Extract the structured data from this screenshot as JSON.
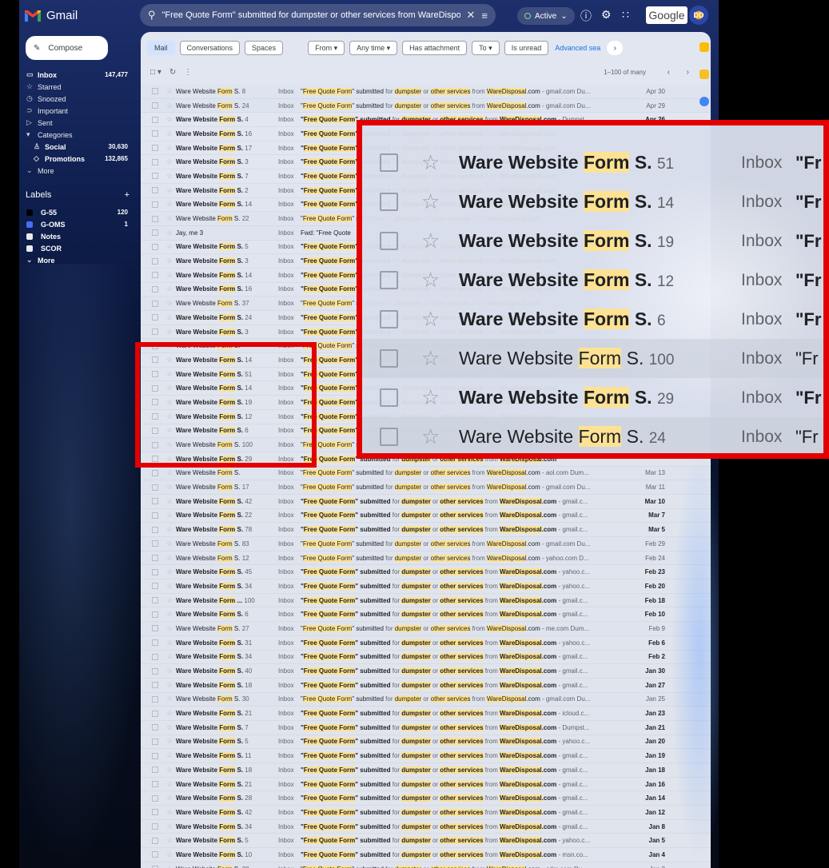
{
  "app": {
    "name": "Gmail",
    "google_label": "Google"
  },
  "search": {
    "query": "\"Free Quote Form\" submitted for dumpster or other services from WareDisposal",
    "clear_icon": "close-icon",
    "options_icon": "tune-icon"
  },
  "status": {
    "label": "Active"
  },
  "header_icons": [
    "help-icon",
    "settings-icon",
    "apps-icon"
  ],
  "avatar": {
    "initials": "DD"
  },
  "compose": {
    "label": "Compose"
  },
  "nav": [
    {
      "label": "Inbox",
      "count": "147,477",
      "bold": true,
      "icon": "inbox-icon",
      "glyph": "▭"
    },
    {
      "label": "Starred",
      "count": "",
      "bold": false,
      "icon": "star-icon",
      "glyph": "☆"
    },
    {
      "label": "Snoozed",
      "count": "",
      "bold": false,
      "icon": "clock-icon",
      "glyph": "◷"
    },
    {
      "label": "Important",
      "count": "",
      "bold": false,
      "icon": "important-icon",
      "glyph": "⊃"
    },
    {
      "label": "Sent",
      "count": "",
      "bold": false,
      "icon": "send-icon",
      "glyph": "▷"
    },
    {
      "label": "Categories",
      "count": "",
      "bold": false,
      "icon": "category-icon",
      "glyph": "▾"
    },
    {
      "label": "Social",
      "count": "30,630",
      "bold": true,
      "icon": "people-icon",
      "glyph": "♙",
      "sub": true
    },
    {
      "label": "Promotions",
      "count": "132,865",
      "bold": true,
      "icon": "tag-icon",
      "glyph": "◇",
      "sub": true
    },
    {
      "label": "More",
      "count": "",
      "bold": false,
      "icon": "chevron-down-icon",
      "glyph": "⌄"
    }
  ],
  "labels": {
    "title": "Labels",
    "add_glyph": "+",
    "items": [
      {
        "label": "G-55",
        "count": "120",
        "color": "#000000"
      },
      {
        "label": "G-OMS",
        "count": "1",
        "color": "#4a6cf7"
      },
      {
        "label": "Notes",
        "count": "",
        "color": "#e8eaed"
      },
      {
        "label": "SCOR",
        "count": "",
        "color": "#e8eaed"
      },
      {
        "label": "More",
        "count": "",
        "color": ""
      }
    ]
  },
  "filters": {
    "tabs": [
      "Mail",
      "Conversations",
      "Spaces"
    ],
    "chips": [
      "From ▾",
      "Any time ▾",
      "Has attachment",
      "To ▾",
      "Is unread"
    ],
    "advanced": "Advanced sea"
  },
  "toolbar": {
    "range": "1–100 of many"
  },
  "sender_base": "Ware Website ",
  "sender_highlight": "Form",
  "subject": {
    "q1": "\"",
    "hl1": "Free Quote Form",
    "q2": "\" ",
    "w1": "submitted",
    "w2": " for ",
    "hl2": "dumpster",
    "w3": " or ",
    "hl3": "other services",
    "w4": " from ",
    "hl4": "WareDisposal",
    "w5": ".com"
  },
  "inbox_label": "Inbox",
  "emails": [
    {
      "s": "S.",
      "n": "8",
      "u": false,
      "tail": " - gmail.com Du...",
      "d": "Apr 30"
    },
    {
      "s": "S.",
      "n": "24",
      "u": false,
      "tail": " - gmail.com Du...",
      "d": "Apr 29"
    },
    {
      "s": "S.",
      "n": "4",
      "u": true,
      "tail": " - Dumpst...",
      "d": "Apr 26"
    },
    {
      "s": "S.",
      "n": "16",
      "u": true,
      "tail": "",
      "d": ""
    },
    {
      "s": "S.",
      "n": "17",
      "u": true,
      "tail": "",
      "d": ""
    },
    {
      "s": "S.",
      "n": "3",
      "u": true,
      "tail": "",
      "d": ""
    },
    {
      "s": "S.",
      "n": "7",
      "u": true,
      "tail": "",
      "d": ""
    },
    {
      "s": "S.",
      "n": "2",
      "u": true,
      "tail": "",
      "d": ""
    },
    {
      "s": "S.",
      "n": "14",
      "u": true,
      "tail": "",
      "d": ""
    },
    {
      "s": "S.",
      "n": "22",
      "u": false,
      "tail": "",
      "d": ""
    },
    {
      "sender": "Jay, me 3",
      "u": false,
      "tail": "",
      "d": "",
      "fwd": "Fwd: \"Free Quote"
    },
    {
      "s": "S.",
      "n": "5",
      "u": true,
      "tail": "",
      "d": ""
    },
    {
      "s": "S.",
      "n": "3",
      "u": true,
      "tail": "",
      "d": ""
    },
    {
      "s": "S.",
      "n": "14",
      "u": true,
      "tail": "",
      "d": ""
    },
    {
      "s": "S.",
      "n": "16",
      "u": true,
      "tail": "",
      "d": ""
    },
    {
      "s": "S.",
      "n": "37",
      "u": false,
      "tail": "",
      "d": ""
    },
    {
      "s": "S.",
      "n": "24",
      "u": true,
      "tail": "",
      "d": ""
    },
    {
      "s": "S.",
      "n": "3",
      "u": true,
      "tail": "",
      "d": ""
    },
    {
      "s": "S.",
      "n": "",
      "u": false,
      "tail": "",
      "d": ""
    },
    {
      "s": "S.",
      "n": "14",
      "u": true,
      "tail": "",
      "d": ""
    },
    {
      "s": "S.",
      "n": "51",
      "u": true,
      "tail": "",
      "d": ""
    },
    {
      "s": "S.",
      "n": "14",
      "u": true,
      "tail": "",
      "d": ""
    },
    {
      "s": "S.",
      "n": "19",
      "u": true,
      "tail": "",
      "d": ""
    },
    {
      "s": "S.",
      "n": "12",
      "u": true,
      "tail": "",
      "d": ""
    },
    {
      "s": "S.",
      "n": "6",
      "u": true,
      "tail": "",
      "d": ""
    },
    {
      "s": "S.",
      "n": "100",
      "u": false,
      "tail": "",
      "d": ""
    },
    {
      "s": "S.",
      "n": "29",
      "u": true,
      "tail": "",
      "d": ""
    },
    {
      "s": "S.",
      "n": "",
      "u": false,
      "tail": " - aol.com Dum...",
      "d": "Mar 13"
    },
    {
      "s": "S.",
      "n": "17",
      "u": false,
      "tail": " - gmail.com Du...",
      "d": "Mar 11"
    },
    {
      "s": "S.",
      "n": "42",
      "u": true,
      "tail": " - gmail.c...",
      "d": "Mar 10"
    },
    {
      "s": "S.",
      "n": "22",
      "u": true,
      "tail": " - gmail.c...",
      "d": "Mar 7"
    },
    {
      "s": "S.",
      "n": "78",
      "u": true,
      "tail": " - gmail.c...",
      "d": "Mar 5"
    },
    {
      "s": "S.",
      "n": "83",
      "u": false,
      "tail": " - gmail.com Du...",
      "d": "Feb 29"
    },
    {
      "s": "S.",
      "n": "12",
      "u": false,
      "tail": " - yahoo.com D...",
      "d": "Feb 24"
    },
    {
      "s": "S.",
      "n": "45",
      "u": true,
      "tail": " - yahoo.c...",
      "d": "Feb 23"
    },
    {
      "s": "S.",
      "n": "34",
      "u": true,
      "tail": " - yahoo.c...",
      "d": "Feb 20"
    },
    {
      "s": "...",
      "n": "100",
      "u": true,
      "tail": " - gmail.c...",
      "d": "Feb 18"
    },
    {
      "s": "S.",
      "n": "6",
      "u": true,
      "tail": " - gmail.c...",
      "d": "Feb 10"
    },
    {
      "s": "S.",
      "n": "27",
      "u": false,
      "tail": " - me.com Dum...",
      "d": "Feb 9"
    },
    {
      "s": "S.",
      "n": "31",
      "u": true,
      "tail": " - yahoo.c...",
      "d": "Feb 6"
    },
    {
      "s": "S.",
      "n": "34",
      "u": true,
      "tail": " - gmail.c...",
      "d": "Feb 2"
    },
    {
      "s": "S.",
      "n": "40",
      "u": true,
      "tail": " - gmail.c...",
      "d": "Jan 30"
    },
    {
      "s": "S.",
      "n": "18",
      "u": true,
      "tail": " - gmail.c...",
      "d": "Jan 27"
    },
    {
      "s": "S.",
      "n": "30",
      "u": false,
      "tail": " - gmail.com Du...",
      "d": "Jan 25"
    },
    {
      "s": "S.",
      "n": "21",
      "u": true,
      "tail": " - icloud.c...",
      "d": "Jan 23"
    },
    {
      "s": "S.",
      "n": "7",
      "u": true,
      "tail": " - Dumpst...",
      "d": "Jan 21"
    },
    {
      "s": "S.",
      "n": "5",
      "u": true,
      "tail": " - yahoo.c...",
      "d": "Jan 20"
    },
    {
      "s": "S.",
      "n": "11",
      "u": true,
      "tail": " - gmail.c...",
      "d": "Jan 19"
    },
    {
      "s": "S.",
      "n": "18",
      "u": true,
      "tail": " - gmail.c...",
      "d": "Jan 18"
    },
    {
      "s": "S.",
      "n": "21",
      "u": true,
      "tail": " - gmail.c...",
      "d": "Jan 16"
    },
    {
      "s": "S.",
      "n": "28",
      "u": true,
      "tail": " - gmail.c...",
      "d": "Jan 14"
    },
    {
      "s": "S.",
      "n": "42",
      "u": true,
      "tail": " - gmail.c...",
      "d": "Jan 12"
    },
    {
      "s": "S.",
      "n": "34",
      "u": true,
      "tail": " - gmail.c...",
      "d": "Jan 8"
    },
    {
      "s": "S.",
      "n": "5",
      "u": true,
      "tail": " - yahoo.c...",
      "d": "Jan 5"
    },
    {
      "s": "S.",
      "n": "10",
      "u": true,
      "tail": " - msn.co...",
      "d": "Jan 4"
    },
    {
      "s": "S.",
      "n": "28",
      "u": false,
      "tail": " - odm.com Du...",
      "d": "Jan 3"
    }
  ],
  "zoom": {
    "subject_prefix": "\"Fr",
    "rows": [
      {
        "s": "S.",
        "n": "51",
        "u": true
      },
      {
        "s": "S.",
        "n": "14",
        "u": true
      },
      {
        "s": "S.",
        "n": "19",
        "u": true
      },
      {
        "s": "S.",
        "n": "12",
        "u": true
      },
      {
        "s": "S.",
        "n": "6",
        "u": true
      },
      {
        "s": "S.",
        "n": "100",
        "u": false
      },
      {
        "s": "S.",
        "n": "29",
        "u": true
      },
      {
        "s": "S.",
        "n": "24",
        "u": false
      }
    ]
  },
  "colors": {
    "highlight": "#fde293",
    "annotation_red": "#e30000",
    "link_blue": "#1a73e8"
  }
}
